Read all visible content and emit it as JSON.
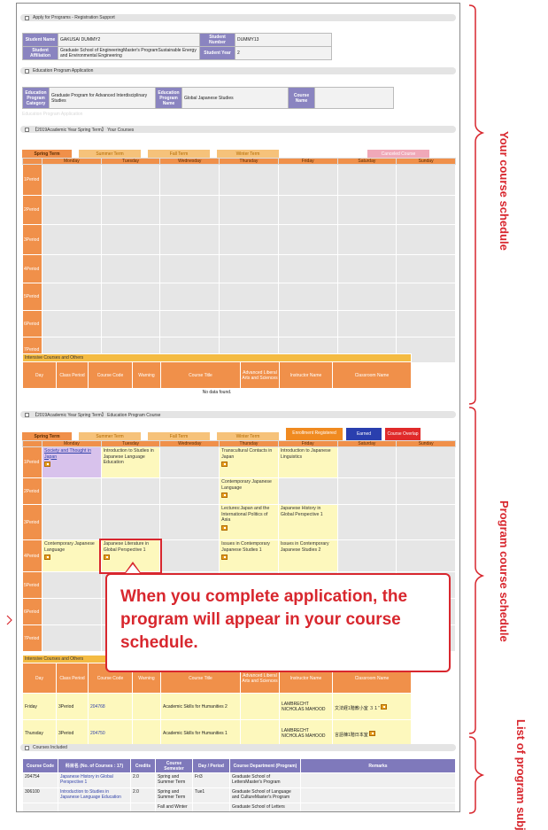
{
  "header": {
    "title": "Apply for Programs - Registration Support"
  },
  "student": {
    "name_label": "Student Name",
    "name": "GAKUSAI DUMMY2",
    "number_label": "Student Number",
    "number": "DUMMY13",
    "affil_label": "Student Affiliation",
    "affil": "Graduate School of EngineeringMaster's ProgramSustainable Energy and Environmental Engineering",
    "year_label": "Student Year",
    "year": "2"
  },
  "application": {
    "title": "Education Program Application",
    "cat_label": "Education Program Category",
    "cat": "Graduate Program for Advanced Interdisciplinary Studies",
    "name_label": "Education Program Name",
    "name": "Global Japanese Studies",
    "course_label": "Course Name",
    "course": "",
    "sub": "Education Program Application"
  },
  "your_courses": {
    "title": "【2019Academic Year Spring Term】 Your Courses",
    "tabs": [
      "Spring Term",
      "Summer Term",
      "Fall Term",
      "Winter Term",
      "Canceled Course"
    ],
    "days": [
      "Monday",
      "Tuesday",
      "Wednesday",
      "Thursday",
      "Friday",
      "Saturday",
      "Sunday"
    ],
    "periods": [
      "1Period",
      "2Period",
      "3Period",
      "4Period",
      "5Period",
      "6Period",
      "7Period"
    ],
    "intensive": {
      "title": "Intensive Courses and Others",
      "cols": [
        "Day",
        "Class Period",
        "Course Code",
        "Warning",
        "Course Title",
        "Advanced Liberal Arts and Sciences",
        "Instructor Name",
        "Classroom Name"
      ],
      "empty": "No data found."
    }
  },
  "program_courses": {
    "title": "【2019Academic Year Spring Term】 Education Program Course",
    "tabs": [
      "Spring Term",
      "Summer Term",
      "Fall Term",
      "Winter Term",
      "Enrollment Registered",
      "Earned",
      "Course Overlap"
    ],
    "courses": {
      "mon1": "Society and Thought in Japan",
      "tue1": "Introduction to Studies in Japanese Language Education",
      "thu1": "Transcultural Contacts in Japan",
      "fri1": "Introduction to Japanese Linguistics",
      "thu2": "Contemporary Japanese Language",
      "thu3": "Lectures:Japan and the International Politics of Asia",
      "fri3": "Japanese History in Global Perspective 1",
      "mon4": "Contemporary Japanese Language",
      "tue4": "Japanese Literature in Global Perspective 1",
      "thu4": "Issues in Contemporary Japanese Studies 1",
      "fri4": "Issues in Contemporary Japanese Studies 2"
    },
    "intensive": {
      "title": "Intensive Courses and Others",
      "cols": [
        "Day",
        "Class Period",
        "Course Code",
        "Warning",
        "Course Title",
        "Advanced Liberal Arts and Sciences",
        "Instructor Name",
        "Classroom Name"
      ],
      "rows": [
        {
          "day": "Friday",
          "period": "3Period",
          "code": "204768",
          "title": "Academic Skills for Humanities 2",
          "inst": "LAMBRECHT NICHOLAS MAHOOD",
          "room": "文法経1階教小室 ３１”"
        },
        {
          "day": "Thursday",
          "period": "3Period",
          "code": "204750",
          "title": "Academic Skills for Humanities 1",
          "inst": "LAMBRECHT NICHOLAS MAHOOD",
          "room": "言語棟1階日本室"
        }
      ]
    }
  },
  "included": {
    "title": "Courses Included",
    "cols": [
      "Course Code",
      "科目名 (No. of Courses : 17)",
      "Credits",
      "Course Semester",
      "Day / Period",
      "Course Department (Program)",
      "Remarks"
    ],
    "rows": [
      {
        "code": "204754",
        "name": "Japanese History in Global Perspective 1",
        "credits": "2.0",
        "sem": "Spring and Summer Term",
        "dp": "Fri3",
        "dept": "Graduate School of LettersMaster's Program"
      },
      {
        "code": "306100",
        "name": "Introduction to Studies in Japanese Language Education",
        "credits": "2.0",
        "sem": "Spring and Summer Term",
        "dp": "Tue1",
        "dept": "Graduate School of Language and CultureMaster's Program"
      },
      {
        "code": "",
        "name": "",
        "credits": "",
        "sem": "Fall and Winter",
        "dp": "",
        "dept": "Graduate School of Letters"
      }
    ]
  },
  "callout": "When you complete application, the program will appear in your course schedule.",
  "side": {
    "a": "Your course schedule",
    "b": "Program course schedule",
    "c": "List of program subjects"
  },
  "colors": {
    "accent": "#d8272e",
    "orange": "#f0904a",
    "purple": "#7f79bb",
    "yellow": "#fdf8bd"
  }
}
